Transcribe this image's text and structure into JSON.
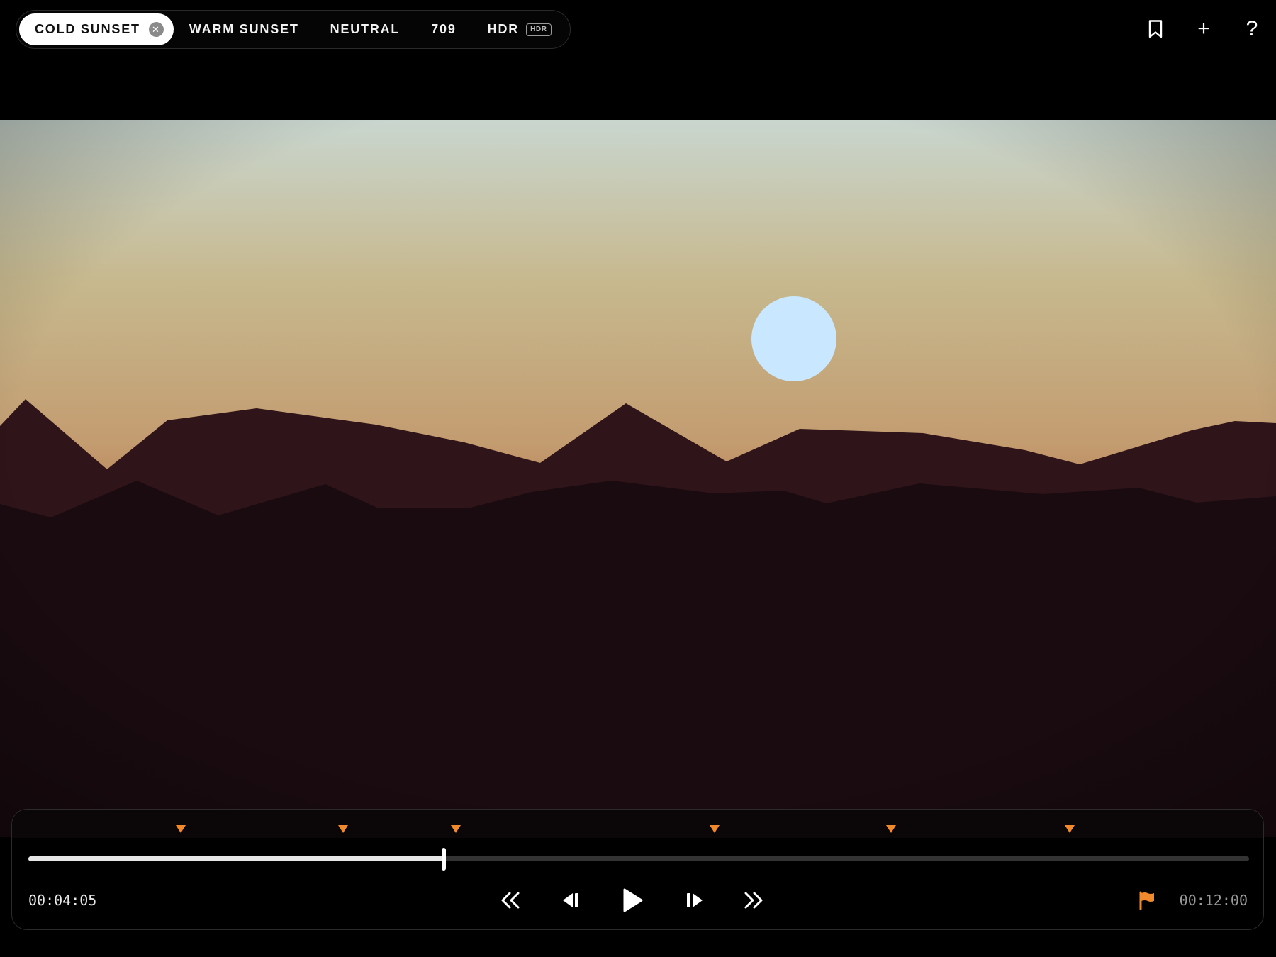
{
  "presets": [
    {
      "label": "COLD SUNSET",
      "active": true
    },
    {
      "label": "WARM SUNSET",
      "active": false
    },
    {
      "label": "NEUTRAL",
      "active": false
    },
    {
      "label": "709",
      "active": false
    },
    {
      "label": "HDR",
      "active": false,
      "badge": "HDR"
    }
  ],
  "top_actions": [
    {
      "name": "bookmark-icon"
    },
    {
      "name": "add-icon",
      "glyph": "+"
    },
    {
      "name": "help-icon",
      "glyph": "?"
    }
  ],
  "player": {
    "current_time": "00:04:05",
    "total_time": "00:12:00",
    "progress": 0.3403,
    "markers": [
      0.125,
      0.258,
      0.35,
      0.562,
      0.707,
      0.853
    ]
  },
  "colors": {
    "accent": "#f08a2c",
    "sun": "#c9e8ff"
  }
}
